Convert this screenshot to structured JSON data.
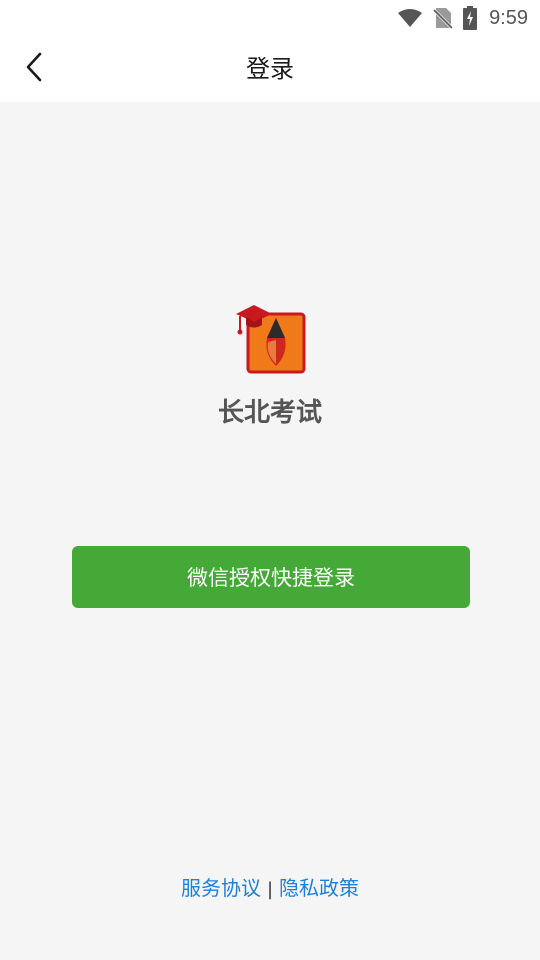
{
  "status_bar": {
    "time": "9:59",
    "icons": [
      "wifi-icon",
      "no-sim-icon",
      "battery-charging-icon"
    ]
  },
  "header": {
    "back_icon": "chevron-left-icon",
    "title": "登录"
  },
  "main": {
    "logo_icon": "graduation-cap-pencil-logo",
    "app_name": "长北考试",
    "login_button_label": "微信授权快捷登录"
  },
  "footer": {
    "terms_label": "服务协议",
    "separator": "|",
    "privacy_label": "隐私政策"
  },
  "colors": {
    "background": "#f5f5f5",
    "header_background": "#ffffff",
    "primary_button": "#45a938",
    "link": "#1f7fd6",
    "logo_orange": "#f07a1a",
    "logo_red": "#c8191e"
  }
}
